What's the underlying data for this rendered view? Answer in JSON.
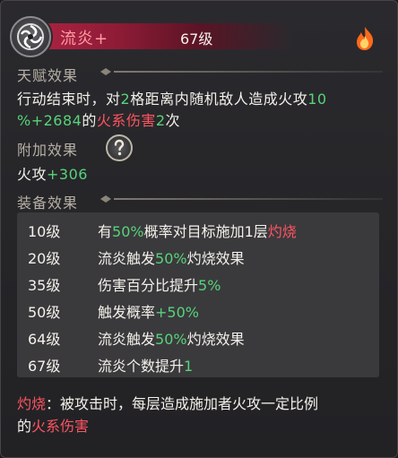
{
  "header": {
    "skill_name": "流炎+",
    "level": "67级",
    "emblem_icon": "swirl-emblem-icon",
    "badge_icon": "fire-icon"
  },
  "talent": {
    "title": "天赋效果",
    "line1": {
      "a": "行动结束时，对",
      "b": "2",
      "c": "格距离内随机敌人造成火攻",
      "d": "10"
    },
    "line2": {
      "a": "%+2684",
      "b": "的",
      "c": "火系伤害",
      "d": "2",
      "e": "次"
    }
  },
  "extra": {
    "title": "附加效果",
    "help_icon": "question-icon",
    "stat_label": "火攻",
    "stat_value": "+306"
  },
  "equip": {
    "title": "装备效果",
    "rows": [
      {
        "level": "10级",
        "parts": [
          "有",
          "50%",
          "概率对目标施加1层",
          "灼烧"
        ]
      },
      {
        "level": "20级",
        "parts": [
          "流炎触发",
          "50%",
          "灼烧效果"
        ]
      },
      {
        "level": "35级",
        "parts": [
          "伤害百分比提升",
          "5%"
        ]
      },
      {
        "level": "50级",
        "parts": [
          "触发概率",
          "+50%"
        ]
      },
      {
        "level": "64级",
        "parts": [
          "流炎触发",
          "50%",
          "灼烧效果"
        ]
      },
      {
        "level": "67级",
        "parts": [
          "流炎个数提升",
          "1"
        ]
      }
    ]
  },
  "note": {
    "keyword": "灼烧",
    "text1": "：被攻击时，每层造成施加者火攻一定比例",
    "text2a": "的",
    "text2b": "火系伤害"
  },
  "colors": {
    "accent_red": "#ff5460",
    "accent_green": "#58d37a",
    "header_red": "#b02443"
  }
}
